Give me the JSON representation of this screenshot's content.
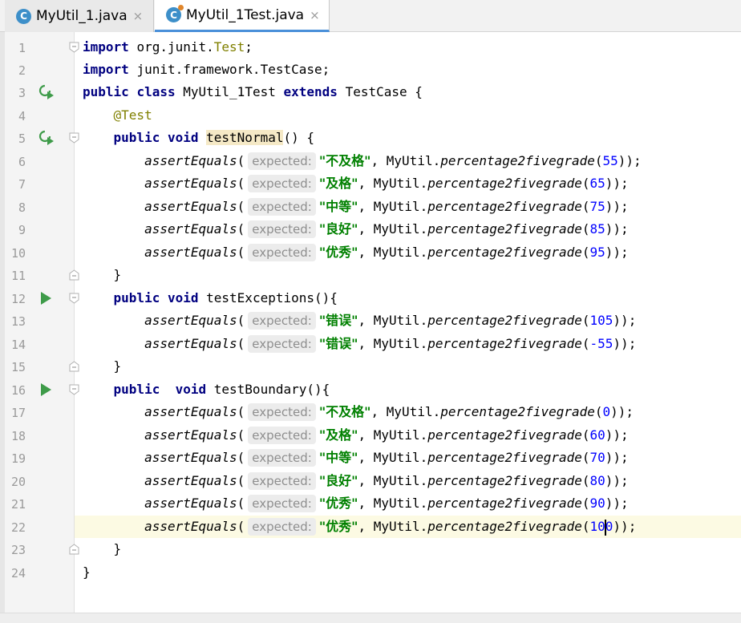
{
  "tabs": [
    {
      "icon": "C",
      "name": "MyUtil_1.java",
      "close": "×"
    },
    {
      "icon": "C",
      "name": "MyUtil_1Test.java",
      "close": "×"
    }
  ],
  "line_numbers": [
    "1",
    "2",
    "3",
    "4",
    "5",
    "6",
    "7",
    "8",
    "9",
    "10",
    "11",
    "12",
    "13",
    "14",
    "15",
    "16",
    "17",
    "18",
    "19",
    "20",
    "21",
    "22",
    "23",
    "24"
  ],
  "code": {
    "kw_import": "import",
    "pkg_junit": "org.junit.",
    "cls_Test": "Test",
    "semi": ";",
    "pkg_framework": "junit.framework.TestCase",
    "kw_public": "public",
    "kw_class": "class",
    "cls_name": "MyUtil_1Test",
    "kw_extends": "extends",
    "super_cls": "TestCase",
    "brace_open": "{",
    "brace_close": "}",
    "annotation": "@Test",
    "kw_void": "void",
    "m_normal": "testNormal",
    "m_exceptions": "testExceptions",
    "m_boundary": "testBoundary",
    "parens": "()",
    "assert_fn": "assertEquals",
    "hint": "expected:",
    "util": "MyUtil.",
    "method_call": "percentage2fivegrade"
  },
  "asserts": [
    {
      "line": 6,
      "grade": "\"不及格\"",
      "arg": "55"
    },
    {
      "line": 7,
      "grade": "\"及格\"",
      "arg": "65"
    },
    {
      "line": 8,
      "grade": "\"中等\"",
      "arg": "75"
    },
    {
      "line": 9,
      "grade": "\"良好\"",
      "arg": "85"
    },
    {
      "line": 10,
      "grade": "\"优秀\"",
      "arg": "95"
    },
    {
      "line": 13,
      "grade": "\"错误\"",
      "arg": "105"
    },
    {
      "line": 14,
      "grade": "\"错误\"",
      "arg": "-55"
    },
    {
      "line": 17,
      "grade": "\"不及格\"",
      "arg": "0"
    },
    {
      "line": 18,
      "grade": "\"及格\"",
      "arg": "60"
    },
    {
      "line": 19,
      "grade": "\"中等\"",
      "arg": "70"
    },
    {
      "line": 20,
      "grade": "\"良好\"",
      "arg": "80"
    },
    {
      "line": 21,
      "grade": "\"优秀\"",
      "arg": "90"
    },
    {
      "line": 22,
      "grade": "\"优秀\"",
      "arg_a": "10",
      "arg_b": "0"
    }
  ],
  "colors": {
    "keyword": "#000080",
    "annotation": "#808000",
    "string": "#008000",
    "number": "#0000ff",
    "current_line": "#fcfae3",
    "run_icon": "#3e9b49"
  }
}
